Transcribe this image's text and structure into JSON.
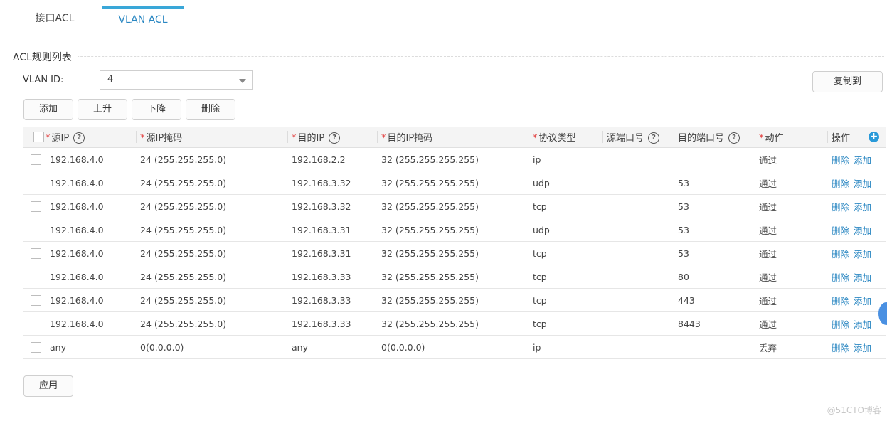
{
  "tabs": [
    {
      "label": "接口ACL"
    },
    {
      "label": "VLAN ACL"
    }
  ],
  "section": {
    "title": "ACL规则列表"
  },
  "vlan": {
    "label": "VLAN ID:",
    "value": "4"
  },
  "buttons": {
    "copy": "复制到",
    "add": "添加",
    "up": "上升",
    "down": "下降",
    "delete": "删除",
    "apply": "应用"
  },
  "table": {
    "headers": {
      "src_ip": "源IP",
      "src_mask": "源IP掩码",
      "dst_ip": "目的IP",
      "dst_mask": "目的IP掩码",
      "protocol": "协议类型",
      "src_port": "源端口号",
      "dst_port": "目的端口号",
      "action": "动作",
      "ops": "操作"
    },
    "rows": [
      {
        "src_ip": "192.168.4.0",
        "src_mask": "24 (255.255.255.0)",
        "dst_ip": "192.168.2.2",
        "dst_mask": "32 (255.255.255.255)",
        "protocol": "ip",
        "src_port": "",
        "dst_port": "",
        "action": "通过",
        "del": "删除",
        "add": "添加"
      },
      {
        "src_ip": "192.168.4.0",
        "src_mask": "24 (255.255.255.0)",
        "dst_ip": "192.168.3.32",
        "dst_mask": "32 (255.255.255.255)",
        "protocol": "udp",
        "src_port": "",
        "dst_port": "53",
        "action": "通过",
        "del": "删除",
        "add": "添加"
      },
      {
        "src_ip": "192.168.4.0",
        "src_mask": "24 (255.255.255.0)",
        "dst_ip": "192.168.3.32",
        "dst_mask": "32 (255.255.255.255)",
        "protocol": "tcp",
        "src_port": "",
        "dst_port": "53",
        "action": "通过",
        "del": "删除",
        "add": "添加"
      },
      {
        "src_ip": "192.168.4.0",
        "src_mask": "24 (255.255.255.0)",
        "dst_ip": "192.168.3.31",
        "dst_mask": "32 (255.255.255.255)",
        "protocol": "udp",
        "src_port": "",
        "dst_port": "53",
        "action": "通过",
        "del": "删除",
        "add": "添加"
      },
      {
        "src_ip": "192.168.4.0",
        "src_mask": "24 (255.255.255.0)",
        "dst_ip": "192.168.3.31",
        "dst_mask": "32 (255.255.255.255)",
        "protocol": "tcp",
        "src_port": "",
        "dst_port": "53",
        "action": "通过",
        "del": "删除",
        "add": "添加"
      },
      {
        "src_ip": "192.168.4.0",
        "src_mask": "24 (255.255.255.0)",
        "dst_ip": "192.168.3.33",
        "dst_mask": "32 (255.255.255.255)",
        "protocol": "tcp",
        "src_port": "",
        "dst_port": "80",
        "action": "通过",
        "del": "删除",
        "add": "添加"
      },
      {
        "src_ip": "192.168.4.0",
        "src_mask": "24 (255.255.255.0)",
        "dst_ip": "192.168.3.33",
        "dst_mask": "32 (255.255.255.255)",
        "protocol": "tcp",
        "src_port": "",
        "dst_port": "443",
        "action": "通过",
        "del": "删除",
        "add": "添加"
      },
      {
        "src_ip": "192.168.4.0",
        "src_mask": "24 (255.255.255.0)",
        "dst_ip": "192.168.3.33",
        "dst_mask": "32 (255.255.255.255)",
        "protocol": "tcp",
        "src_port": "",
        "dst_port": "8443",
        "action": "通过",
        "del": "删除",
        "add": "添加"
      },
      {
        "src_ip": "any",
        "src_mask": "0(0.0.0.0)",
        "dst_ip": "any",
        "dst_mask": "0(0.0.0.0)",
        "protocol": "ip",
        "src_port": "",
        "dst_port": "",
        "action": "丢弃",
        "del": "删除",
        "add": "添加"
      }
    ]
  },
  "watermark": "@51CTO博客"
}
